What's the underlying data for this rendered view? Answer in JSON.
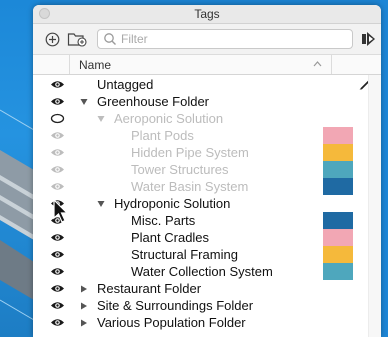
{
  "window": {
    "title": "Tags"
  },
  "toolbar": {
    "add_icon": "add-tag-icon",
    "folder_icon": "add-folder-icon",
    "search_icon": "search-icon",
    "filter_placeholder": "Filter",
    "filter_value": "",
    "details_icon": "details-arrow-icon"
  },
  "header": {
    "name_label": "Name"
  },
  "colors": {
    "pink": "#f2a7b4",
    "yellow": "#f5b93b",
    "teal": "#4ea7bd",
    "blue": "#1f6aa3"
  },
  "rows": [
    {
      "label": "Untagged",
      "indent": 0,
      "toggle": "none",
      "visible": true,
      "dim": false,
      "color": "",
      "pencil": true
    },
    {
      "label": "Greenhouse Folder",
      "indent": 0,
      "toggle": "open",
      "visible": true,
      "dim": false,
      "color": ""
    },
    {
      "label": "Aeroponic Solution",
      "indent": 1,
      "toggle": "open",
      "visible": false,
      "dim": true,
      "color": ""
    },
    {
      "label": "Plant Pods",
      "indent": 2,
      "toggle": "none",
      "visible": true,
      "dim": true,
      "color": "#f2a7b4"
    },
    {
      "label": "Hidden Pipe System",
      "indent": 2,
      "toggle": "none",
      "visible": true,
      "dim": true,
      "color": "#f5b93b"
    },
    {
      "label": "Tower Structures",
      "indent": 2,
      "toggle": "none",
      "visible": true,
      "dim": true,
      "color": "#4ea7bd"
    },
    {
      "label": "Water Basin System",
      "indent": 2,
      "toggle": "none",
      "visible": true,
      "dim": true,
      "color": "#1f6aa3"
    },
    {
      "label": "Hydroponic Solution",
      "indent": 1,
      "toggle": "open",
      "visible": true,
      "dim": false,
      "color": ""
    },
    {
      "label": "Misc. Parts",
      "indent": 2,
      "toggle": "none",
      "visible": true,
      "dim": false,
      "color": "#1f6aa3"
    },
    {
      "label": "Plant Cradles",
      "indent": 2,
      "toggle": "none",
      "visible": true,
      "dim": false,
      "color": "#f2a7b4"
    },
    {
      "label": "Structural Framing",
      "indent": 2,
      "toggle": "none",
      "visible": true,
      "dim": false,
      "color": "#f5b93b"
    },
    {
      "label": "Water Collection System",
      "indent": 2,
      "toggle": "none",
      "visible": true,
      "dim": false,
      "color": "#4ea7bd"
    },
    {
      "label": "Restaurant Folder",
      "indent": 0,
      "toggle": "closed",
      "visible": true,
      "dim": false,
      "color": ""
    },
    {
      "label": "Site & Surroundings Folder",
      "indent": 0,
      "toggle": "closed",
      "visible": true,
      "dim": false,
      "color": ""
    },
    {
      "label": "Various Population Folder",
      "indent": 0,
      "toggle": "closed",
      "visible": true,
      "dim": false,
      "color": ""
    }
  ]
}
